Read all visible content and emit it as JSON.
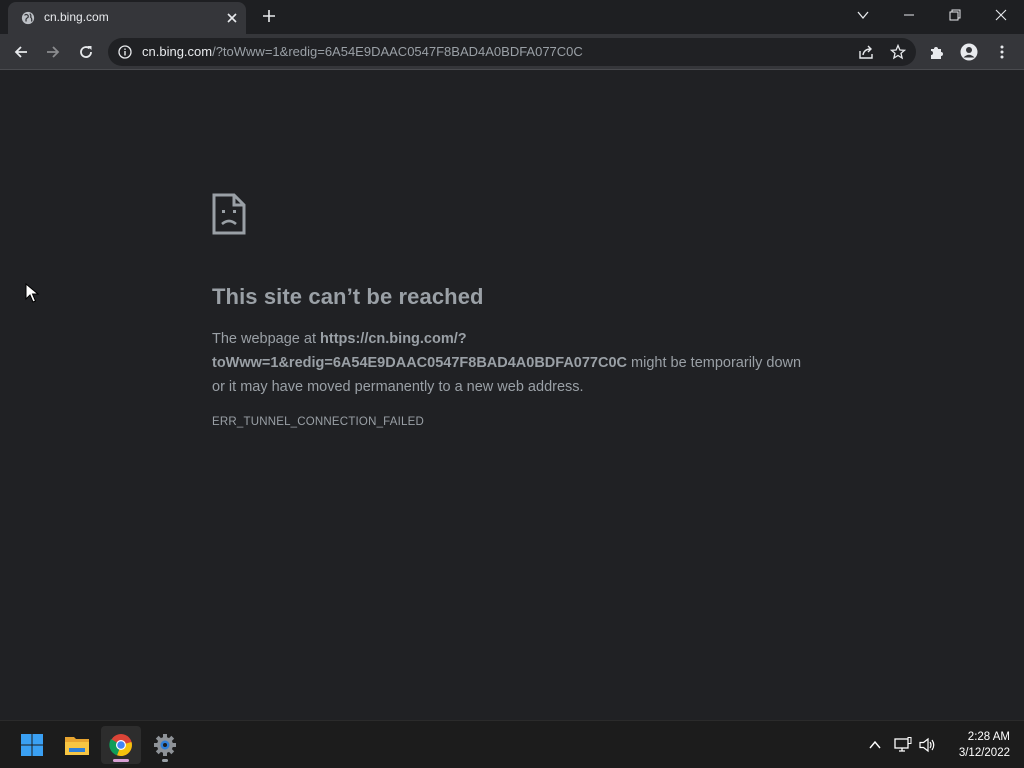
{
  "browser": {
    "tab": {
      "title": "cn.bing.com"
    },
    "address": {
      "host": "cn.bing.com",
      "path": "/?toWww=1&redig=6A54E9DAAC0547F8BAD4A0BDFA077C0C"
    }
  },
  "error": {
    "title": "This site can’t be reached",
    "desc_prefix": "The webpage at ",
    "url_bold_1": "https://cn.bing.com/?",
    "url_bold_2": "toWww=1&redig=6A54E9DAAC0547F8BAD4A0BDFA077C0C",
    "desc_suffix": " might be temporarily down or it may have moved permanently to a new web address.",
    "code": "ERR_TUNNEL_CONNECTION_FAILED"
  },
  "taskbar": {
    "apps": [
      "start-icon",
      "file-explorer-icon",
      "chrome-icon",
      "settings-icon"
    ],
    "clock": {
      "time": "2:28 AM",
      "date": "3/12/2022"
    }
  },
  "colors": {
    "page_bg": "#202124",
    "toolbar_bg": "#35363a",
    "text_muted": "#9aa0a6",
    "text_primary": "#e8eaed",
    "taskbar_bg": "#1c1c1c"
  }
}
